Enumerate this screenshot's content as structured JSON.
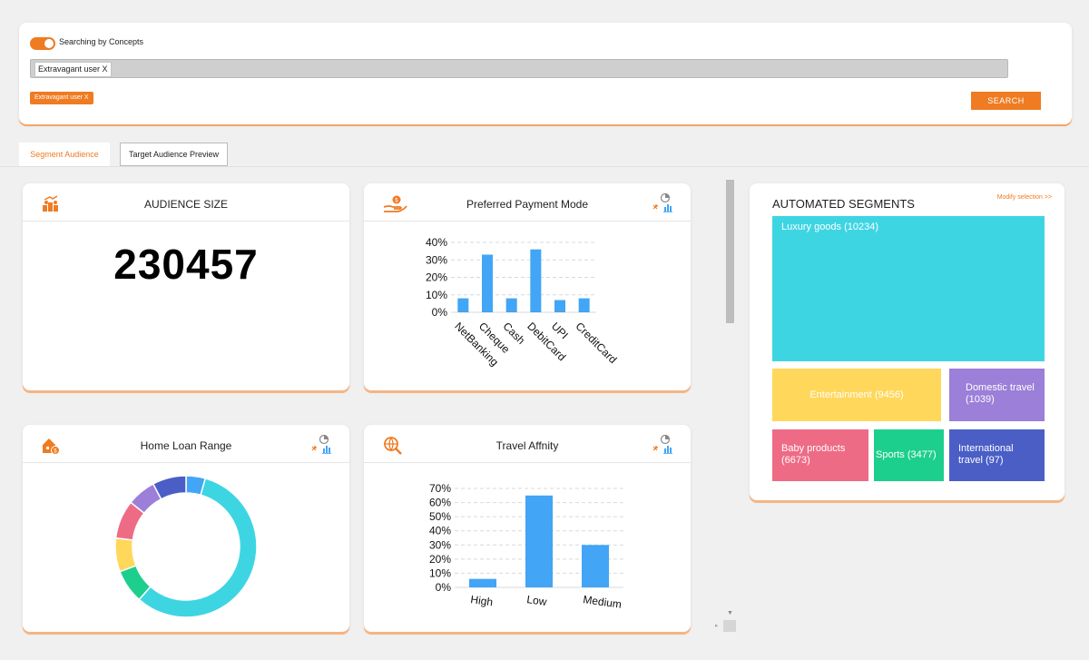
{
  "search": {
    "toggle_label": "Searching by Concepts",
    "query": "Extravagant user X",
    "chip": "Extravagant user X",
    "button": "SEARCH"
  },
  "tabs": [
    {
      "label": "Segment Audience",
      "active": true
    },
    {
      "label": "Target Audience Preview",
      "active": false
    }
  ],
  "audience": {
    "title": "AUDIENCE SIZE",
    "value": "230457"
  },
  "payment": {
    "title": "Preferred Payment Mode"
  },
  "homeloan": {
    "title": "Home Loan Range"
  },
  "travel": {
    "title": "Travel Affnity"
  },
  "segments": {
    "title": "AUTOMATED SEGMENTS",
    "modify": "Modify selection >>",
    "tiles": [
      {
        "label": "Luxury goods (10234)",
        "color": "#3ed5e3"
      },
      {
        "label": "Entertainment (9456)",
        "color": "#ffd75a"
      },
      {
        "label": "Domestic travel (1039)",
        "color": "#9b7fd8"
      },
      {
        "label": "Baby products (6673)",
        "color": "#ee6b86"
      },
      {
        "label": "Sports (3477)",
        "color": "#1dcf8c"
      },
      {
        "label": "International travel (97)",
        "color": "#4a5ec6"
      }
    ]
  },
  "colors": {
    "accent": "#ef7b22",
    "bar": "#42a5f5"
  },
  "chart_data": [
    {
      "type": "bar",
      "title": "Preferred Payment Mode",
      "categories": [
        "NetBanking",
        "Cheque",
        "Cash",
        "DebitCard",
        "UPI",
        "CreditCard"
      ],
      "values": [
        8,
        33,
        8,
        36,
        7,
        8
      ],
      "ylim": [
        0,
        40
      ],
      "yticks": [
        "0%",
        "10%",
        "20%",
        "30%",
        "40%"
      ]
    },
    {
      "type": "pie",
      "title": "Home Loan Range",
      "values": [
        4,
        52,
        7,
        7,
        8,
        6,
        7
      ],
      "colors": [
        "#42a5f5",
        "#3ed5e3",
        "#1dcf8c",
        "#ffd75a",
        "#ee6b86",
        "#9b7fd8",
        "#4a5ec6"
      ]
    },
    {
      "type": "bar",
      "title": "Travel Affnity",
      "categories": [
        "High",
        "Low",
        "Medium"
      ],
      "values": [
        6,
        65,
        30
      ],
      "ylim": [
        0,
        70
      ],
      "yticks": [
        "0%",
        "10%",
        "20%",
        "30%",
        "40%",
        "50%",
        "60%",
        "70%"
      ]
    }
  ]
}
